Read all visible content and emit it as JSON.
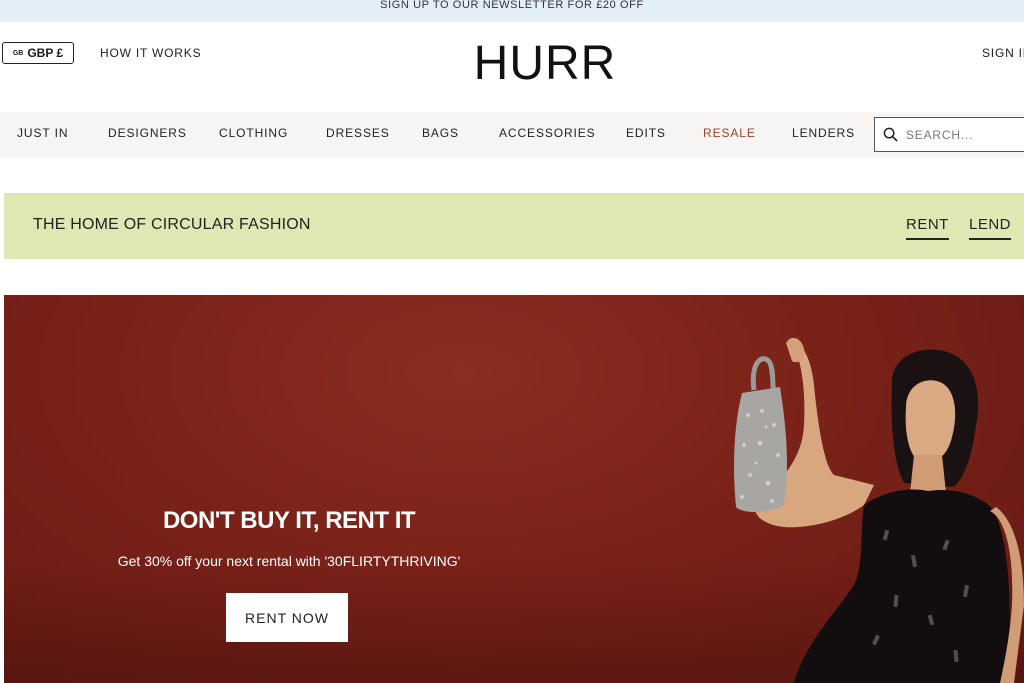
{
  "promo": {
    "text": "SIGN UP TO OUR NEWSLETTER FOR £20 OFF"
  },
  "header": {
    "currency_flag": "GB",
    "currency_label": "GBP £",
    "how_it_works": "HOW IT WORKS",
    "logo": "HURR",
    "sign_in": "SIGN IN"
  },
  "nav": {
    "items": [
      {
        "label": "JUST IN"
      },
      {
        "label": "DESIGNERS"
      },
      {
        "label": "CLOTHING"
      },
      {
        "label": "DRESSES"
      },
      {
        "label": "BAGS"
      },
      {
        "label": "ACCESSORIES"
      },
      {
        "label": "EDITS"
      },
      {
        "label": "RESALE",
        "color": "#a0412c"
      },
      {
        "label": "LENDERS"
      }
    ],
    "search_placeholder": "SEARCH...",
    "search_icon": "search-icon"
  },
  "circular": {
    "title": "THE HOME OF CIRCULAR FASHION",
    "rent": "RENT",
    "lend": "LEND",
    "background": "#dfe8b3"
  },
  "hero": {
    "headline": "DON'T BUY IT, RENT IT",
    "subtext": "Get 30% off your next rental with '30FLIRTYTHRIVING'",
    "cta": "RENT NOW",
    "background": "#7a2219"
  }
}
